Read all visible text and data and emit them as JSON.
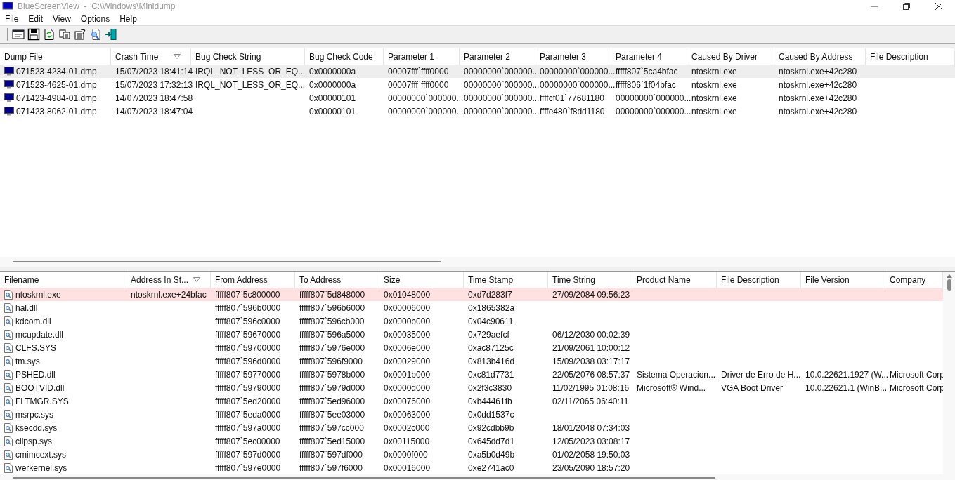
{
  "window": {
    "title": "BlueScreenView  -  C:\\Windows\\Minidump"
  },
  "menu": [
    "File",
    "Edit",
    "View",
    "Options",
    "Help"
  ],
  "toolbar": [
    {
      "kind": "properties"
    },
    {
      "kind": "save"
    },
    {
      "kind": "refresh"
    },
    {
      "kind": "copy"
    },
    {
      "kind": "options"
    },
    {
      "kind": "find"
    },
    {
      "kind": "exit"
    }
  ],
  "dump_table": {
    "columns": [
      {
        "label": "Dump File",
        "sorted": false
      },
      {
        "label": "Crash Time",
        "sorted": true
      },
      {
        "label": "Bug Check String",
        "sorted": false
      },
      {
        "label": "Bug Check Code",
        "sorted": false
      },
      {
        "label": "Parameter 1",
        "sorted": false
      },
      {
        "label": "Parameter 2",
        "sorted": false
      },
      {
        "label": "Parameter 3",
        "sorted": false
      },
      {
        "label": "Parameter 4",
        "sorted": false
      },
      {
        "label": "Caused By Driver",
        "sorted": false
      },
      {
        "label": "Caused By Address",
        "sorted": false
      },
      {
        "label": "File Description",
        "sorted": false
      }
    ],
    "rows": [
      {
        "selected": true,
        "cells": [
          "071523-4234-01.dmp",
          "15/07/2023 18:41:14",
          "IRQL_NOT_LESS_OR_EQ...",
          "0x0000000a",
          "00007fff`ffff0000",
          "00000000`000000...",
          "00000000`000000...",
          "fffff807`5ca4bfac",
          "ntoskrnl.exe",
          "ntoskrnl.exe+42c280",
          ""
        ]
      },
      {
        "selected": false,
        "cells": [
          "071523-4625-01.dmp",
          "15/07/2023 17:32:13",
          "IRQL_NOT_LESS_OR_EQ...",
          "0x0000000a",
          "00007fff`ffff0000",
          "00000000`000000...",
          "00000000`000000...",
          "fffff806`1f04bfac",
          "ntoskrnl.exe",
          "ntoskrnl.exe+42c280",
          ""
        ]
      },
      {
        "selected": false,
        "cells": [
          "071423-4984-01.dmp",
          "14/07/2023 18:47:58",
          "",
          "0x00000101",
          "00000000`000000...",
          "00000000`000000...",
          "ffffcf01`77681180",
          "00000000`000000...",
          "ntoskrnl.exe",
          "ntoskrnl.exe+42c280",
          ""
        ]
      },
      {
        "selected": false,
        "cells": [
          "071423-8062-01.dmp",
          "14/07/2023 18:47:04",
          "",
          "0x00000101",
          "00000000`000000...",
          "00000000`000000...",
          "ffffe480`f8dd1180",
          "00000000`000000...",
          "ntoskrnl.exe",
          "ntoskrnl.exe+42c280",
          ""
        ]
      }
    ]
  },
  "driver_table": {
    "columns": [
      {
        "label": "Filename",
        "sorted": false
      },
      {
        "label": "Address In St...",
        "sorted": true
      },
      {
        "label": "From Address",
        "sorted": false
      },
      {
        "label": "To Address",
        "sorted": false
      },
      {
        "label": "Size",
        "sorted": false
      },
      {
        "label": "Time Stamp",
        "sorted": false
      },
      {
        "label": "Time String",
        "sorted": false
      },
      {
        "label": "Product Name",
        "sorted": false
      },
      {
        "label": "File Description",
        "sorted": false
      },
      {
        "label": "File Version",
        "sorted": false
      },
      {
        "label": "Company",
        "sorted": false
      }
    ],
    "rows": [
      {
        "highlighted": true,
        "cells": [
          "ntoskrnl.exe",
          "ntoskrnl.exe+24bfac",
          "fffff807`5c800000",
          "fffff807`5d848000",
          "0x01048000",
          "0xd7d283f7",
          "27/09/2084 09:56:23",
          "",
          "",
          "",
          ""
        ]
      },
      {
        "highlighted": false,
        "cells": [
          "hal.dll",
          "",
          "fffff807`596b0000",
          "fffff807`596b6000",
          "0x00006000",
          "0x1865382a",
          "",
          "",
          "",
          "",
          ""
        ]
      },
      {
        "highlighted": false,
        "cells": [
          "kdcom.dll",
          "",
          "fffff807`596c0000",
          "fffff807`596cb000",
          "0x0000b000",
          "0x04c90611",
          "",
          "",
          "",
          "",
          ""
        ]
      },
      {
        "highlighted": false,
        "cells": [
          "mcupdate.dll",
          "",
          "fffff807`59670000",
          "fffff807`596a5000",
          "0x00035000",
          "0x729aefcf",
          "06/12/2030 00:02:39",
          "",
          "",
          "",
          ""
        ]
      },
      {
        "highlighted": false,
        "cells": [
          "CLFS.SYS",
          "",
          "fffff807`59700000",
          "fffff807`5976e000",
          "0x0006e000",
          "0xac87125c",
          "21/09/2061 10:00:12",
          "",
          "",
          "",
          ""
        ]
      },
      {
        "highlighted": false,
        "cells": [
          "tm.sys",
          "",
          "fffff807`596d0000",
          "fffff807`596f9000",
          "0x00029000",
          "0x813b416d",
          "15/09/2038 03:17:17",
          "",
          "",
          "",
          ""
        ]
      },
      {
        "highlighted": false,
        "cells": [
          "PSHED.dll",
          "",
          "fffff807`59770000",
          "fffff807`5978b000",
          "0x0001b000",
          "0xc81d7731",
          "22/05/2076 08:57:37",
          "Sistema Operacion...",
          "Driver de Erro de H...",
          "10.0.22621.1927 (W...",
          "Microsoft Corp"
        ]
      },
      {
        "highlighted": false,
        "cells": [
          "BOOTVID.dll",
          "",
          "fffff807`59790000",
          "fffff807`5979d000",
          "0x0000d000",
          "0x2f3c3830",
          "11/02/1995 01:08:16",
          "Microsoft® Wind...",
          "VGA Boot Driver",
          "10.0.22621.1 (WinB...",
          "Microsoft Corp"
        ]
      },
      {
        "highlighted": false,
        "cells": [
          "FLTMGR.SYS",
          "",
          "fffff807`5ed20000",
          "fffff807`5ed96000",
          "0x00076000",
          "0xb44461fb",
          "02/11/2065 06:40:11",
          "",
          "",
          "",
          ""
        ]
      },
      {
        "highlighted": false,
        "cells": [
          "msrpc.sys",
          "",
          "fffff807`5eda0000",
          "fffff807`5ee03000",
          "0x00063000",
          "0x0dd1537c",
          "",
          "",
          "",
          "",
          ""
        ]
      },
      {
        "highlighted": false,
        "cells": [
          "ksecdd.sys",
          "",
          "fffff807`597a0000",
          "fffff807`597cc000",
          "0x0002c000",
          "0x92cdbb9b",
          "18/01/2048 07:34:03",
          "",
          "",
          "",
          ""
        ]
      },
      {
        "highlighted": false,
        "cells": [
          "clipsp.sys",
          "",
          "fffff807`5ec00000",
          "fffff807`5ed15000",
          "0x00115000",
          "0x645dd7d1",
          "12/05/2023 03:08:17",
          "",
          "",
          "",
          ""
        ]
      },
      {
        "highlighted": false,
        "cells": [
          "cmimcext.sys",
          "",
          "fffff807`597d0000",
          "fffff807`597df000",
          "0x0000f000",
          "0xa5b0d49b",
          "01/02/2058 19:50:03",
          "",
          "",
          "",
          ""
        ]
      },
      {
        "highlighted": false,
        "cells": [
          "werkernel.sys",
          "",
          "fffff807`597e0000",
          "fffff807`597f6000",
          "0x00016000",
          "0xe2741ac0",
          "23/05/2090 18:57:20",
          "",
          "",
          "",
          ""
        ]
      }
    ]
  }
}
